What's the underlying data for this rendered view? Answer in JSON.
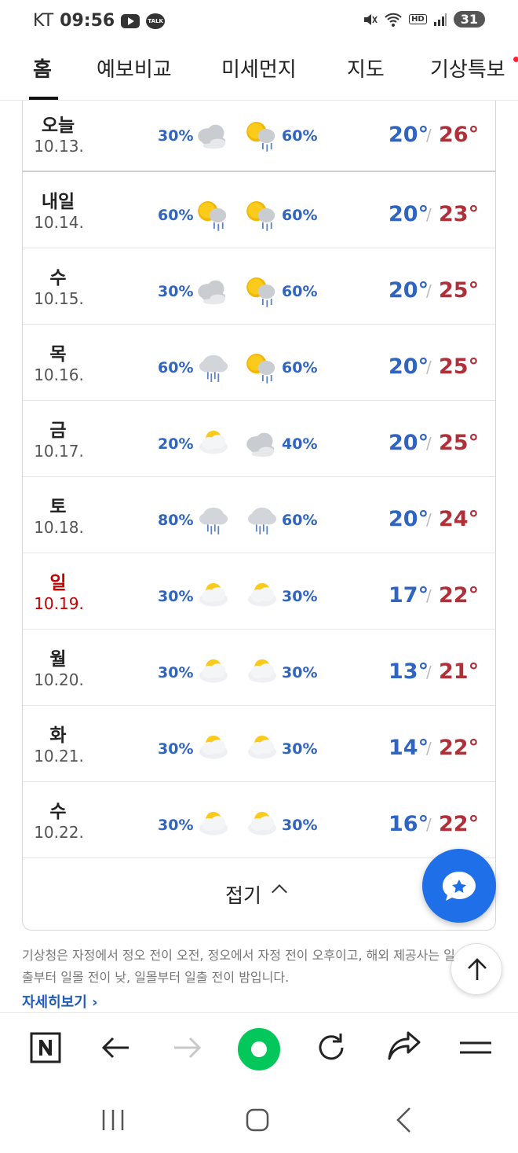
{
  "status_bar": {
    "carrier": "KT",
    "time": "09:56",
    "battery": "31",
    "icons": [
      "youtube-icon",
      "kakaotalk-icon",
      "mute-icon",
      "wifi-icon",
      "hd-icon",
      "signal-icon"
    ],
    "hd_label": "HD",
    "talk_label": "TALK"
  },
  "tabs": [
    {
      "label": "홈",
      "active": true
    },
    {
      "label": "예보비교",
      "active": false
    },
    {
      "label": "미세먼지",
      "active": false
    },
    {
      "label": "지도",
      "active": false
    },
    {
      "label": "기상특보",
      "active": false
    }
  ],
  "forecast": {
    "days": [
      {
        "day": "오늘",
        "date": "10.13.",
        "am_pct": "30%",
        "pm_pct": "60%",
        "am_icon": "cloudy-icon",
        "pm_icon": "sun-cloud-rain-icon",
        "low": "20°",
        "high": "26°",
        "sunday": false
      },
      {
        "day": "내일",
        "date": "10.14.",
        "am_pct": "60%",
        "pm_pct": "60%",
        "am_icon": "sun-cloud-rain-icon",
        "pm_icon": "sun-cloud-rain-icon",
        "low": "20°",
        "high": "23°",
        "sunday": false
      },
      {
        "day": "수",
        "date": "10.15.",
        "am_pct": "30%",
        "pm_pct": "60%",
        "am_icon": "cloudy-icon",
        "pm_icon": "sun-cloud-rain-icon",
        "low": "20°",
        "high": "25°",
        "sunday": false
      },
      {
        "day": "목",
        "date": "10.16.",
        "am_pct": "60%",
        "pm_pct": "60%",
        "am_icon": "cloud-rain-icon",
        "pm_icon": "sun-cloud-rain-icon",
        "low": "20°",
        "high": "25°",
        "sunday": false
      },
      {
        "day": "금",
        "date": "10.17.",
        "am_pct": "20%",
        "pm_pct": "40%",
        "am_icon": "partly-cloudy-icon",
        "pm_icon": "cloudy-icon",
        "low": "20°",
        "high": "25°",
        "sunday": false
      },
      {
        "day": "토",
        "date": "10.18.",
        "am_pct": "80%",
        "pm_pct": "60%",
        "am_icon": "cloud-rain-icon",
        "pm_icon": "cloud-rain-icon",
        "low": "20°",
        "high": "24°",
        "sunday": false
      },
      {
        "day": "일",
        "date": "10.19.",
        "am_pct": "30%",
        "pm_pct": "30%",
        "am_icon": "partly-cloudy-icon",
        "pm_icon": "partly-cloudy-icon",
        "low": "17°",
        "high": "22°",
        "sunday": true
      },
      {
        "day": "월",
        "date": "10.20.",
        "am_pct": "30%",
        "pm_pct": "30%",
        "am_icon": "partly-cloudy-icon",
        "pm_icon": "partly-cloudy-icon",
        "low": "13°",
        "high": "21°",
        "sunday": false
      },
      {
        "day": "화",
        "date": "10.21.",
        "am_pct": "30%",
        "pm_pct": "30%",
        "am_icon": "partly-cloudy-icon",
        "pm_icon": "partly-cloudy-icon",
        "low": "14°",
        "high": "22°",
        "sunday": false
      },
      {
        "day": "수",
        "date": "10.22.",
        "am_pct": "30%",
        "pm_pct": "30%",
        "am_icon": "partly-cloudy-icon",
        "pm_icon": "partly-cloudy-icon",
        "low": "16°",
        "high": "22°",
        "sunday": false
      }
    ],
    "slash": "/",
    "fold_label": "접기"
  },
  "notice": {
    "text": "기상청은 자정에서 정오 전이 오전, 정오에서 자정 전이 오후이고, 해외 제공사는 일출부터 일몰 전이 낮, 일몰부터 일출 전이 밤입니다.",
    "more_link": "자세히보기 ›"
  },
  "colors": {
    "low_temp": "#2f64c0",
    "high_temp": "#b0303a",
    "sunday": "#c40000",
    "fab": "#1f6fe8",
    "naver_green": "#03c75a"
  },
  "browser_bar": [
    "naver-home-icon",
    "back-arrow-icon",
    "forward-arrow-icon",
    "green-dot-icon",
    "refresh-icon",
    "share-icon",
    "menu-icon"
  ],
  "system_nav": [
    "recents-icon",
    "home-icon",
    "back-icon"
  ]
}
